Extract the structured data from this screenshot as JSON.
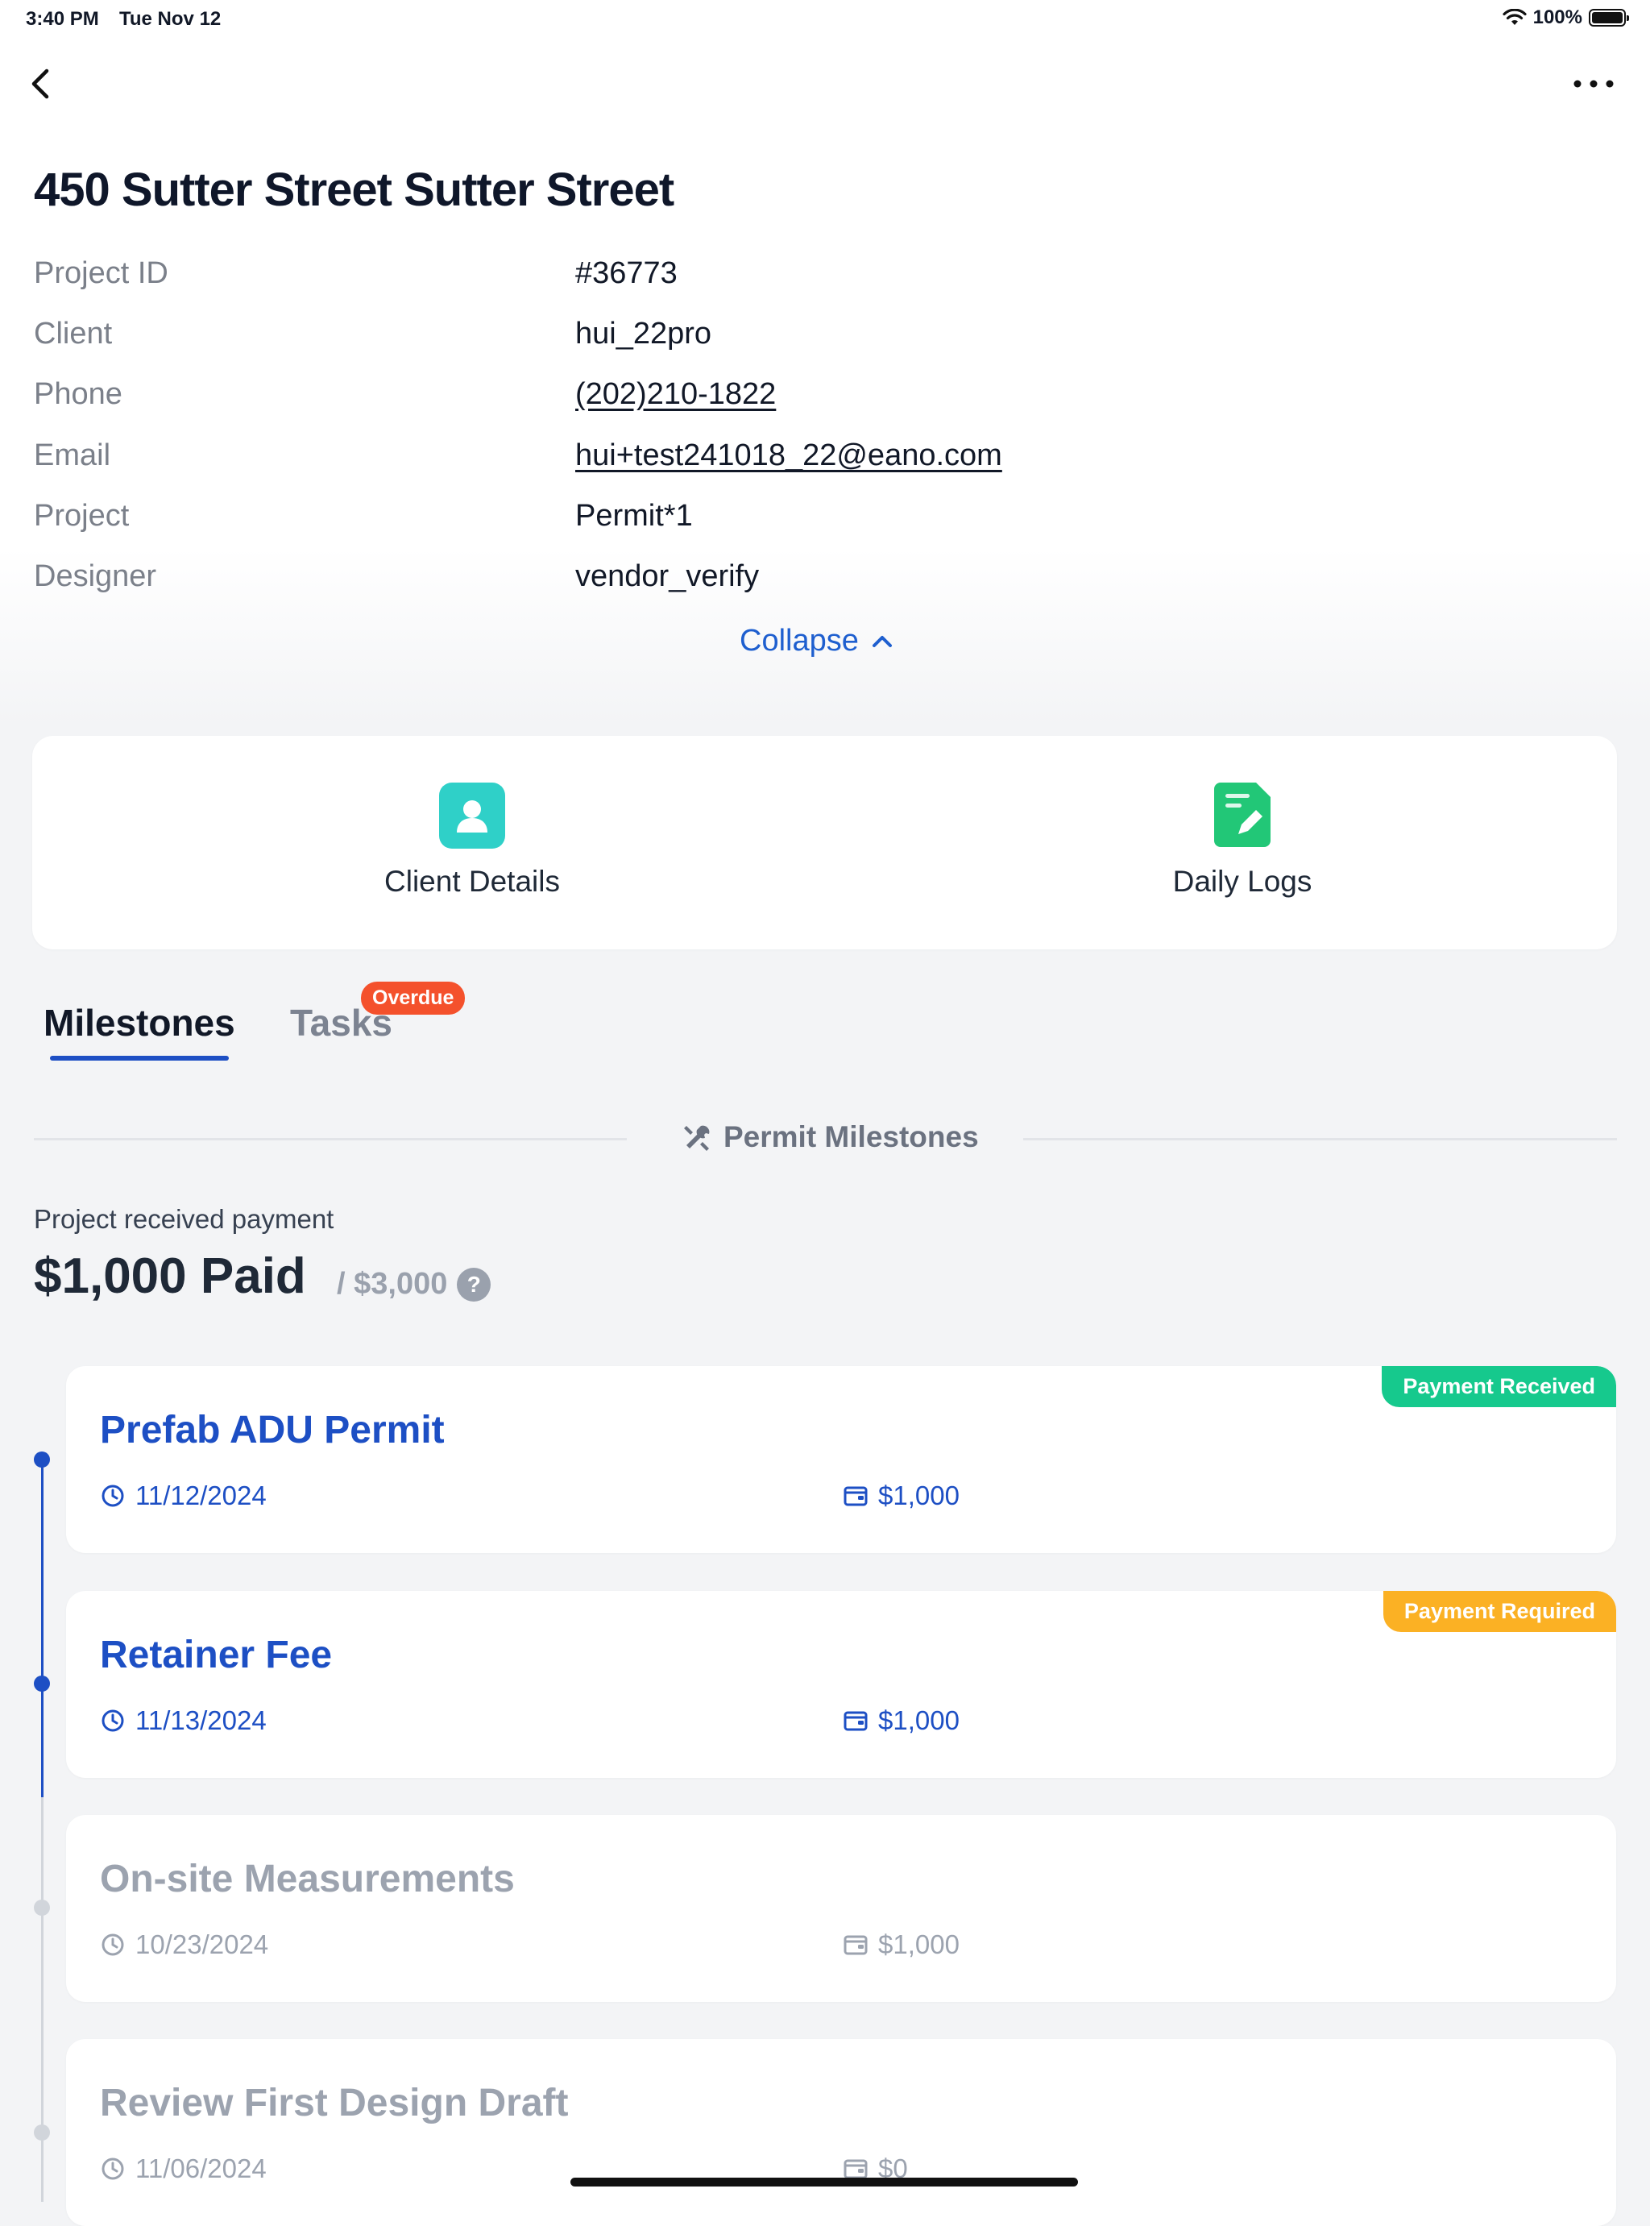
{
  "status_bar": {
    "time": "3:40 PM",
    "date": "Tue Nov 12",
    "battery": "100%"
  },
  "project": {
    "title": "450 Sutter Street Sutter Street",
    "fields": [
      {
        "label": "Project ID",
        "value": "#36773"
      },
      {
        "label": "Client",
        "value": "hui_22pro"
      },
      {
        "label": "Phone",
        "value": "(202)210-1822"
      },
      {
        "label": "Email",
        "value": "hui+test241018_22@eano.com"
      },
      {
        "label": "Project",
        "value": "Permit*1"
      },
      {
        "label": "Designer",
        "value": "vendor_verify"
      }
    ],
    "collapse_label": "Collapse"
  },
  "quick_actions": [
    {
      "label": "Client Details",
      "icon": "person-icon",
      "color": "#2fd0c8"
    },
    {
      "label": "Daily Logs",
      "icon": "edit-log-icon",
      "color": "#22c777"
    }
  ],
  "tabs": [
    {
      "label": "Milestones",
      "active": true
    },
    {
      "label": "Tasks",
      "badge": "Overdue"
    }
  ],
  "section_title": "Permit Milestones",
  "payment": {
    "label": "Project received payment",
    "paid": "$1,000 Paid",
    "total": "/ $3,000"
  },
  "milestones": [
    {
      "title": "Prefab ADU Permit",
      "date": "11/12/2024",
      "amount": "$1,000",
      "badge": "Payment Received",
      "badge_color": "#16c98d"
    },
    {
      "title": "Retainer Fee",
      "date": "11/13/2024",
      "amount": "$1,000",
      "badge": "Payment Required",
      "badge_color": "#fbb124"
    },
    {
      "title": "On-site Measurements",
      "date": "10/23/2024",
      "amount": "$1,000"
    },
    {
      "title": "Review First Design Draft",
      "date": "11/06/2024",
      "amount": "$0"
    }
  ],
  "colors": {
    "accent": "#1d4fc4",
    "overdue": "#f4512c",
    "link": "#1e5fcf"
  }
}
